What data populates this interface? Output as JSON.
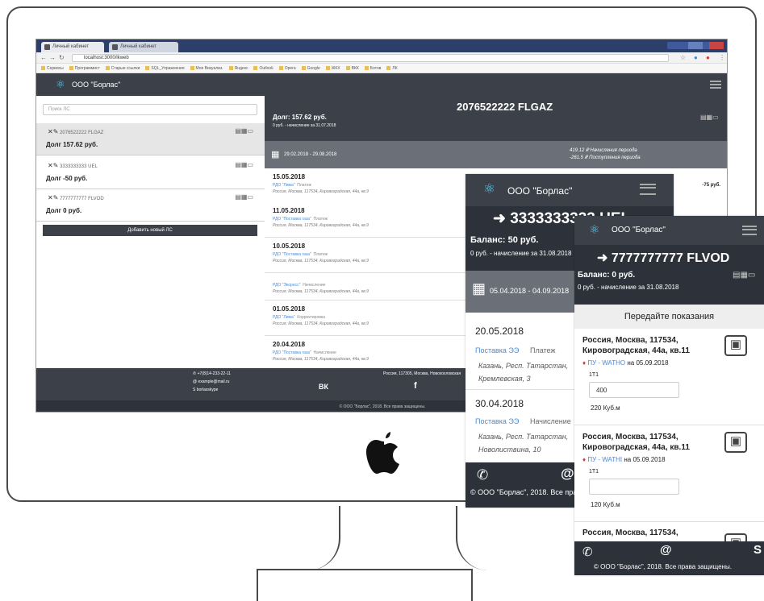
{
  "browser": {
    "tab1": "Личный кабинет",
    "tab2": "Личный кабинет",
    "url": "localhost:3000/lkweb",
    "bookmarks": [
      "Сервисы",
      "Программист",
      "Старые ссылки",
      "SQL_Упражнения",
      "Моя Визуализ.",
      "Яндекс",
      "Outlook",
      "Opera",
      "Google",
      "ЖКХ",
      "ВКК",
      "Ботов",
      "ЛК"
    ]
  },
  "app": {
    "company": "ООО \"Борлас\"",
    "search_placeholder": "Поиск ЛС",
    "accounts": [
      {
        "number": "2076522222 FLGAZ",
        "debt": "Долг 157.62 руб."
      },
      {
        "number": "3333333333 UEL",
        "debt": "Долг -50 руб."
      },
      {
        "number": "7777777777 FLVOD",
        "debt": "Долг 0 руб."
      }
    ],
    "add_button": "Добавить новый ЛС",
    "main_title": "2076522222 FLGAZ",
    "main_debt": "Долг: 157.62 руб.",
    "main_accrual": "0 руб. - начисление за 31.07.2018",
    "period": "29.02.2018 - 29.08.2018",
    "period_charged": "419.12 ₽  Начисления периода",
    "period_paid": "-261.5 ₽  Поступления периода",
    "entries": [
      {
        "date": "15.05.2018",
        "source": "РДО \"Лима\"",
        "type": "Платеж",
        "address": "Россия, Москва, 117534, Кировоградская, 44а, кв.9",
        "amount": "-75 руб."
      },
      {
        "date": "11.05.2018",
        "source": "РДО \"Поставка газа\"",
        "type": "Платеж",
        "address": "Россия, Москва, 117534, Кировоградская, 44а, кв.9",
        "amount": ""
      },
      {
        "date": "10.05.2018",
        "source": "РДО \"Поставка газа\"",
        "type": "Платеж",
        "address": "Россия, Москва, 117534, Кировоградская, 44а, кв.9",
        "amount": ""
      },
      {
        "date": "",
        "source": "РДО \"Экоресс\"",
        "type": "Начисление",
        "address": "Россия, Москва, 117534, Кировоградская, 44а, кв.9",
        "amount": ""
      },
      {
        "date": "01.05.2018",
        "source": "РДО \"Лима\"",
        "type": "Корректировка",
        "address": "Россия, Москва, 117534, Кировоградская, 44а, кв.9",
        "amount": ""
      },
      {
        "date": "20.04.2018",
        "source": "РДО \"Поставка газа\"",
        "type": "Начисление",
        "address": "Россия, Москва, 117534, Кировоградская, 44а, кв.9",
        "amount": ""
      }
    ],
    "footer_phone": "+7(8)14-233-22-11",
    "footer_email": "example@mail.ru",
    "footer_skype": "borlasskype",
    "footer_address": "Россия, 117305, Москва, Новохохловская",
    "footer_vk": "ВК",
    "footer_fb": "f",
    "copyright": "© ООО \"Борлас\", 2018. Все права защищены."
  },
  "phone1": {
    "company": "ООО \"Борлас\"",
    "account": "3333333333 UEL",
    "balance": "Баланс: 50 руб.",
    "accrual": "0 руб. - начисление за 31.08.2018",
    "period": "05.04.2018 - 04.09.2018",
    "entries": [
      {
        "date": "20.05.2018",
        "source": "Поставка ЭЭ",
        "type": "Платеж",
        "address": "Казань, Респ. Татарстан, Кремлевская, 3"
      },
      {
        "date": "30.04.2018",
        "source": "Поставка ЭЭ",
        "type": "Начисление",
        "address": "Казань, Респ. Татарстан, Новолиствина, 10"
      }
    ],
    "copyright": "© ООО \"Борлас\", 2018. Все права защищены."
  },
  "phone2": {
    "company": "ООО \"Борлас\"",
    "account": "7777777777 FLVOD",
    "balance": "Баланс: 0 руб.",
    "accrual": "0 руб. - начисление за 31.08.2018",
    "section_title": "Передайте показания",
    "meters": [
      {
        "address": "Россия, Москва, 117534, Кировоградская, 44а, кв.11",
        "meter_name": "ПУ - WATHO",
        "meter_date": "на 05.09.2018",
        "tariff": "1T1",
        "value": "400",
        "last": "220 Куб.м"
      },
      {
        "address": "Россия, Москва, 117534, Кировоградская, 44а, кв.11",
        "meter_name": "ПУ - WATHI",
        "meter_date": "на 05.09.2018",
        "tariff": "1T1",
        "value": "",
        "last": "120 Куб.м"
      },
      {
        "address": "Россия, Москва, 117534,",
        "meter_name": "",
        "meter_date": "",
        "tariff": "",
        "value": "",
        "last": ""
      }
    ],
    "copyright": "© ООО \"Борлас\", 2018. Все права защищены."
  }
}
